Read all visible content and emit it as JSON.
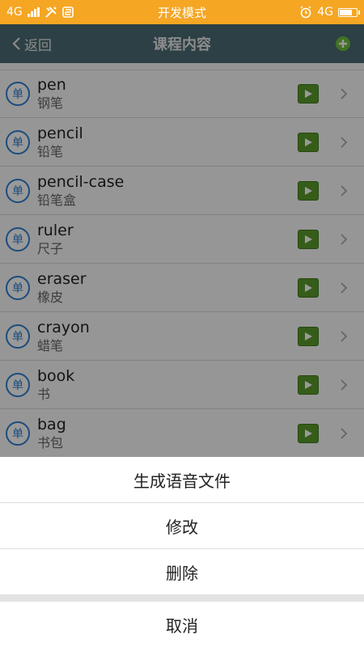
{
  "status_bar": {
    "network_left": "4G",
    "title": "开发模式",
    "network_right": "4G"
  },
  "title_bar": {
    "back_label": "返回",
    "title": "课程内容"
  },
  "list": {
    "badge_label": "单",
    "items": [
      {
        "word": "pen",
        "meaning": "钢笔"
      },
      {
        "word": "pencil",
        "meaning": "铅笔"
      },
      {
        "word": "pencil-case",
        "meaning": "铅笔盒"
      },
      {
        "word": "ruler",
        "meaning": "尺子"
      },
      {
        "word": "eraser",
        "meaning": "橡皮"
      },
      {
        "word": "crayon",
        "meaning": "蜡笔"
      },
      {
        "word": "book",
        "meaning": "书"
      },
      {
        "word": "bag",
        "meaning": "书包"
      }
    ]
  },
  "action_sheet": {
    "generate_audio": "生成语音文件",
    "edit": "修改",
    "delete": "删除",
    "cancel": "取消"
  },
  "colors": {
    "status_bar": "#f5a623",
    "title_bar": "#4a6c73",
    "badge": "#2f7fd0",
    "play_button": "#5a9a2a"
  }
}
